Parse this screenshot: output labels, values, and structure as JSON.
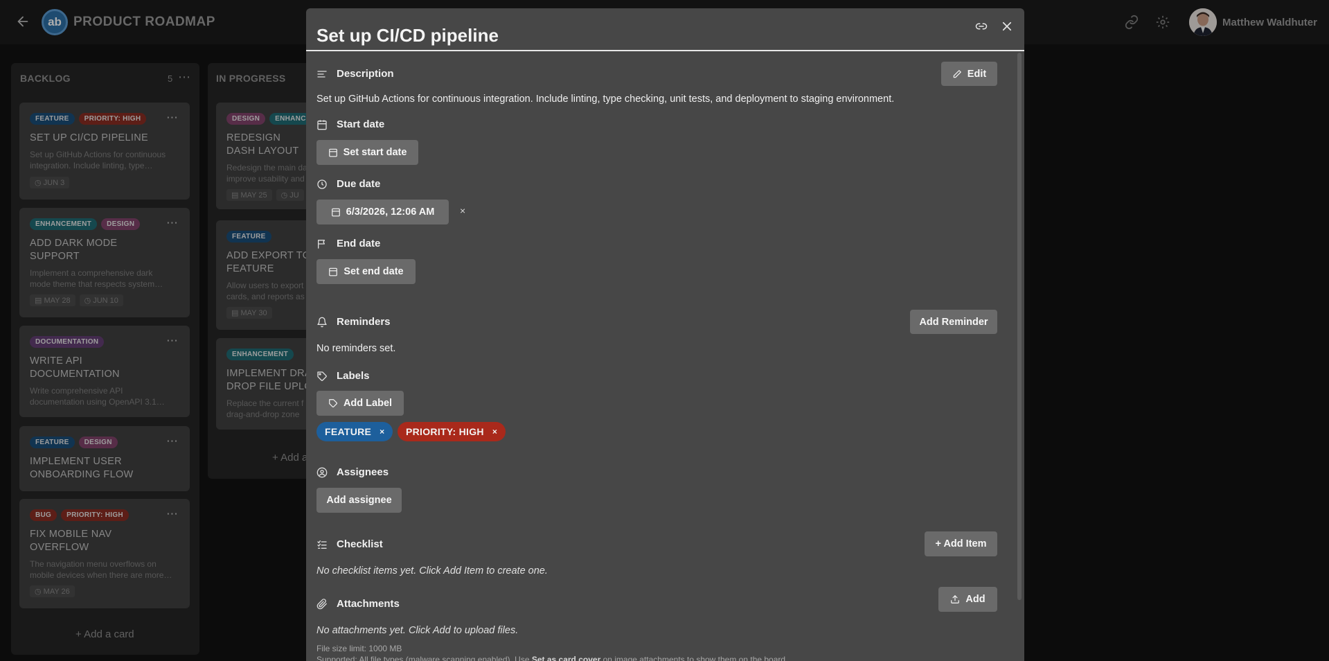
{
  "header": {
    "logo_text": "ab",
    "board_title": "PRODUCT ROADMAP",
    "user_name": "Matthew Waldhuter"
  },
  "columns": [
    {
      "title": "BACKLOG",
      "count": "5",
      "add_card": "+ Add a card",
      "cards": [
        {
          "labels": [
            {
              "text": "FEATURE",
              "kind": "feature"
            },
            {
              "text": "PRIORITY: HIGH",
              "kind": "priority"
            }
          ],
          "title": "SET UP CI/CD PIPELINE",
          "desc": "Set up GitHub Actions for continuous integration. Include linting, type…",
          "dates": [
            "JUN 3"
          ]
        },
        {
          "labels": [
            {
              "text": "ENHANCEMENT",
              "kind": "enhancement"
            },
            {
              "text": "DESIGN",
              "kind": "design"
            }
          ],
          "title": "ADD DARK MODE SUPPORT",
          "desc": "Implement a comprehensive dark mode theme that respects system…",
          "dates": [
            "MAY 28",
            "JUN 10"
          ]
        },
        {
          "labels": [
            {
              "text": "DOCUMENTATION",
              "kind": "docs"
            }
          ],
          "title": "WRITE API DOCUMENTATION",
          "desc": "Write comprehensive API documentation using OpenAPI 3.1…",
          "dates": []
        },
        {
          "labels": [
            {
              "text": "FEATURE",
              "kind": "feature"
            },
            {
              "text": "DESIGN",
              "kind": "design"
            }
          ],
          "title": "IMPLEMENT USER ONBOARDING FLOW",
          "desc": "",
          "dates": []
        },
        {
          "labels": [
            {
              "text": "BUG",
              "kind": "bug"
            },
            {
              "text": "PRIORITY: HIGH",
              "kind": "priority"
            }
          ],
          "title": "FIX MOBILE NAV OVERFLOW",
          "desc": "The navigation menu overflows on mobile devices when there are more…",
          "dates": [
            "MAY 26"
          ]
        }
      ]
    },
    {
      "title": "IN PROGRESS",
      "add_card": "+ Add a",
      "cards": [
        {
          "labels": [
            {
              "text": "DESIGN",
              "kind": "design"
            },
            {
              "text": "ENHANC",
              "kind": "enhancement"
            }
          ],
          "title": "REDESIGN DASH LAYOUT",
          "desc": "Redesign the main da improve usability and",
          "dates": [
            "MAY 25",
            "JU"
          ]
        },
        {
          "labels": [
            {
              "text": "FEATURE",
              "kind": "feature"
            }
          ],
          "title": "ADD EXPORT TO FEATURE",
          "desc": "Allow users to export cards, and reports as",
          "dates": [
            "MAY 30"
          ]
        },
        {
          "labels": [
            {
              "text": "ENHANCEMENT",
              "kind": "enhancement"
            }
          ],
          "title": "IMPLEMENT DRA DROP FILE UPLO",
          "desc": "Replace the current f drag-and-drop zone",
          "dates": []
        }
      ]
    }
  ],
  "modal": {
    "title": "Set up CI/CD pipeline",
    "description": {
      "heading": "Description",
      "edit_label": "Edit",
      "text": "Set up GitHub Actions for continuous integration. Include linting, type checking, unit tests, and deployment to staging environment."
    },
    "start_date": {
      "heading": "Start date",
      "button": "Set start date"
    },
    "due_date": {
      "heading": "Due date",
      "value": "6/3/2026, 12:06 AM",
      "clear": "×"
    },
    "end_date": {
      "heading": "End date",
      "button": "Set end date"
    },
    "reminders": {
      "heading": "Reminders",
      "add": "Add Reminder",
      "empty": "No reminders set."
    },
    "labels": {
      "heading": "Labels",
      "add": "Add Label",
      "chips": [
        {
          "text": "FEATURE",
          "color": "#1d5f9c"
        },
        {
          "text": "PRIORITY: HIGH",
          "color": "#a9291b"
        }
      ],
      "remove": "×"
    },
    "assignees": {
      "heading": "Assignees",
      "add": "Add assignee"
    },
    "checklist": {
      "heading": "Checklist",
      "add": "+ Add Item",
      "empty": "No checklist items yet. Click Add Item to create one."
    },
    "attachments": {
      "heading": "Attachments",
      "add": "Add",
      "empty": "No attachments yet. Click Add to upload files.",
      "size_limit": "File size limit: 1000 MB",
      "supported_prefix": "Supported: All file types (malware scanning enabled). Use ",
      "supported_bold": "Set as card cover",
      "supported_suffix": " on image attachments to show them on the board."
    }
  }
}
